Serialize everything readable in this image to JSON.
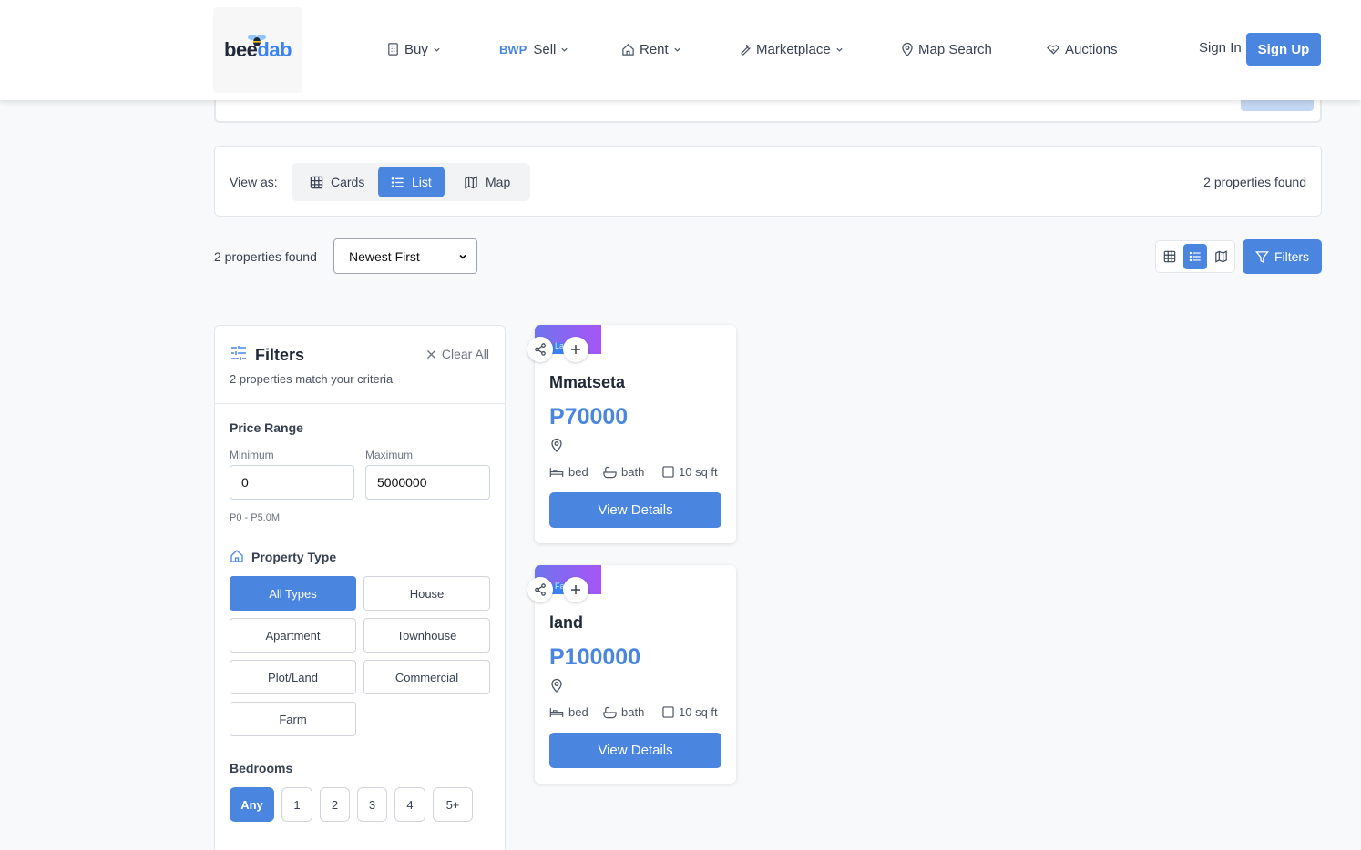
{
  "header": {
    "logo": {
      "part1": "bee",
      "part2": "dab"
    },
    "nav": [
      {
        "label": "Buy",
        "icon": "building-icon"
      },
      {
        "prefix": "BWP",
        "label": "Sell"
      },
      {
        "label": "Rent",
        "icon": "home-icon"
      },
      {
        "label": "Marketplace",
        "icon": "wrench-icon"
      },
      {
        "label": "Map Search",
        "icon": "map-pin-icon"
      },
      {
        "label": "Auctions",
        "icon": "handshake-icon"
      }
    ],
    "sign_in": "Sign In",
    "sign_up": "Sign Up"
  },
  "view_bar": {
    "label": "View as:",
    "options": [
      "Cards",
      "List",
      "Map"
    ],
    "active": "List",
    "count": "2 properties found"
  },
  "toolbar": {
    "count": "2 properties found",
    "sort_value": "Newest First",
    "filters_label": "Filters"
  },
  "filters": {
    "title": "Filters",
    "clear_all": "Clear All",
    "subtitle": "2 properties match your criteria",
    "price": {
      "title": "Price Range",
      "min_label": "Minimum",
      "max_label": "Maximum",
      "min_value": "0",
      "max_value": "5000000",
      "range_text": "P0 - P5.0M"
    },
    "property_type": {
      "title": "Property Type",
      "options": [
        "All Types",
        "House",
        "Apartment",
        "Townhouse",
        "Plot/Land",
        "Commercial",
        "Farm"
      ],
      "selected": "All Types"
    },
    "bedrooms": {
      "title": "Bedrooms",
      "options": [
        "Any",
        "1",
        "2",
        "3",
        "4",
        "5+"
      ],
      "selected": "Any"
    }
  },
  "listings": [
    {
      "tag": "La",
      "title": "Mmatseta",
      "price": "P70000",
      "bed": "bed",
      "bath": "bath",
      "area": "10 sq ft",
      "button": "View Details"
    },
    {
      "tag": "Fa",
      "title": "land",
      "price": "P100000",
      "bed": "bed",
      "bath": "bath",
      "area": "10 sq ft",
      "button": "View Details"
    }
  ],
  "colors": {
    "accent": "#4a86e0",
    "background": "#f8f9fa",
    "thumb_gradient": [
      "#6d74ee",
      "#a855f7"
    ]
  }
}
